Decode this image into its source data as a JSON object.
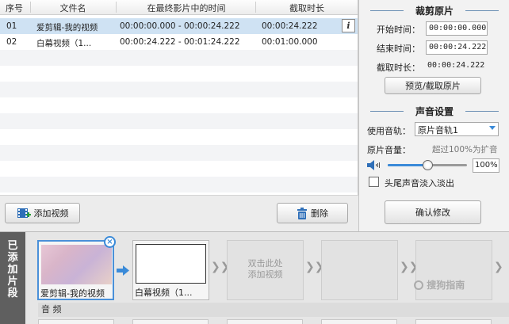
{
  "table": {
    "columns": [
      "序号",
      "文件名",
      "在最终影片中的时间",
      "截取时长"
    ],
    "rows": [
      {
        "index": "01",
        "name": "爱剪辑-我的视频",
        "time_range": "00:00:00.000 - 00:00:24.222",
        "duration": "00:00:24.222"
      },
      {
        "index": "02",
        "name": "白幕视频（1...",
        "time_range": "00:00:24.222 - 00:01:24.222",
        "duration": "00:01:00.000"
      }
    ],
    "info_label": "i"
  },
  "actions": {
    "add_video": "添加视频",
    "delete": "删除"
  },
  "crop": {
    "title": "裁剪原片",
    "start_label": "开始时间：",
    "start_value": "00:00:00.000",
    "end_label": "结束时间：",
    "end_value": "00:00:24.222",
    "duration_label": "截取时长：",
    "duration_value": "00:00:24.222",
    "preview_button": "预览/截取原片"
  },
  "audio": {
    "title": "声音设置",
    "track_label": "使用音轨：",
    "track_value": "原片音轨1",
    "volume_label": "原片音量：",
    "volume_hint": "超过100%为扩音",
    "volume_value": "100%",
    "volume_level": 0.5,
    "fade_label": "头尾声音淡入淡出",
    "confirm_button": "确认修改"
  },
  "strip": {
    "side_tab": [
      "已",
      "添",
      "加",
      "片",
      "段"
    ],
    "clips": [
      {
        "caption": "爱剪辑-我的视频"
      },
      {
        "caption": "白幕视频（1..."
      },
      {
        "caption": "双击此处添加视频"
      }
    ],
    "placeholder_line1": "双击此处",
    "placeholder_line2": "添加视频",
    "audio_label": "音 频",
    "watermark": "搜狗指南"
  },
  "colors": {
    "selected_row": "#cfe2f3",
    "accent": "#3a8ad8"
  }
}
